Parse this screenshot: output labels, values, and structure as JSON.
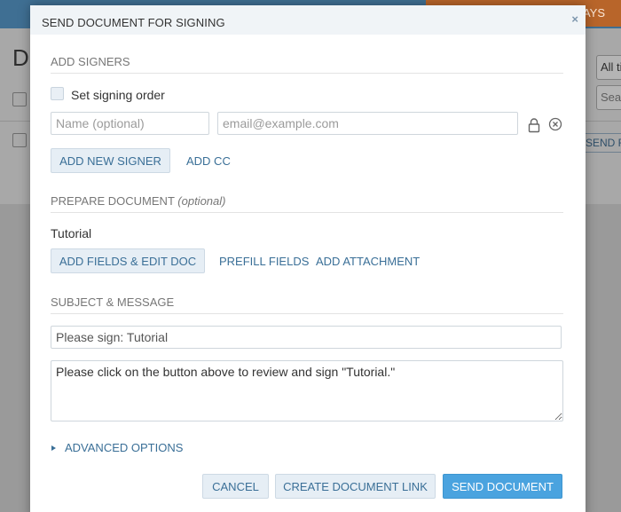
{
  "background": {
    "banner_text": "AYS",
    "page_letter": "D",
    "filter_select": "All ti",
    "search_placeholder": "Sear",
    "send_button": "SEND F"
  },
  "modal": {
    "title": "SEND DOCUMENT FOR SIGNING",
    "close_icon": "×",
    "signers": {
      "heading": "ADD SIGNERS",
      "order_checkbox_label": "Set signing order",
      "order_checked": false,
      "name_placeholder": "Name (optional)",
      "email_placeholder": "email@example.com",
      "add_signer_label": "ADD NEW SIGNER",
      "add_cc_label": "ADD CC"
    },
    "prepare": {
      "heading": "PREPARE DOCUMENT",
      "heading_note": "(optional)",
      "document_name": "Tutorial",
      "add_fields_label": "ADD FIELDS & EDIT DOC",
      "prefill_label": "PREFILL FIELDS",
      "attachment_label": "ADD ATTACHMENT"
    },
    "message": {
      "heading": "SUBJECT & MESSAGE",
      "subject_value": "Please sign: Tutorial",
      "body_value": "Please click on the button above to review and sign \"Tutorial.\""
    },
    "advanced_label": "ADVANCED OPTIONS",
    "footer": {
      "cancel_label": "CANCEL",
      "link_label": "CREATE DOCUMENT LINK",
      "send_label": "SEND DOCUMENT"
    }
  },
  "colors": {
    "accent": "#4aa3df",
    "link": "#3a6f97",
    "header_bg": "#f0f4f7"
  }
}
